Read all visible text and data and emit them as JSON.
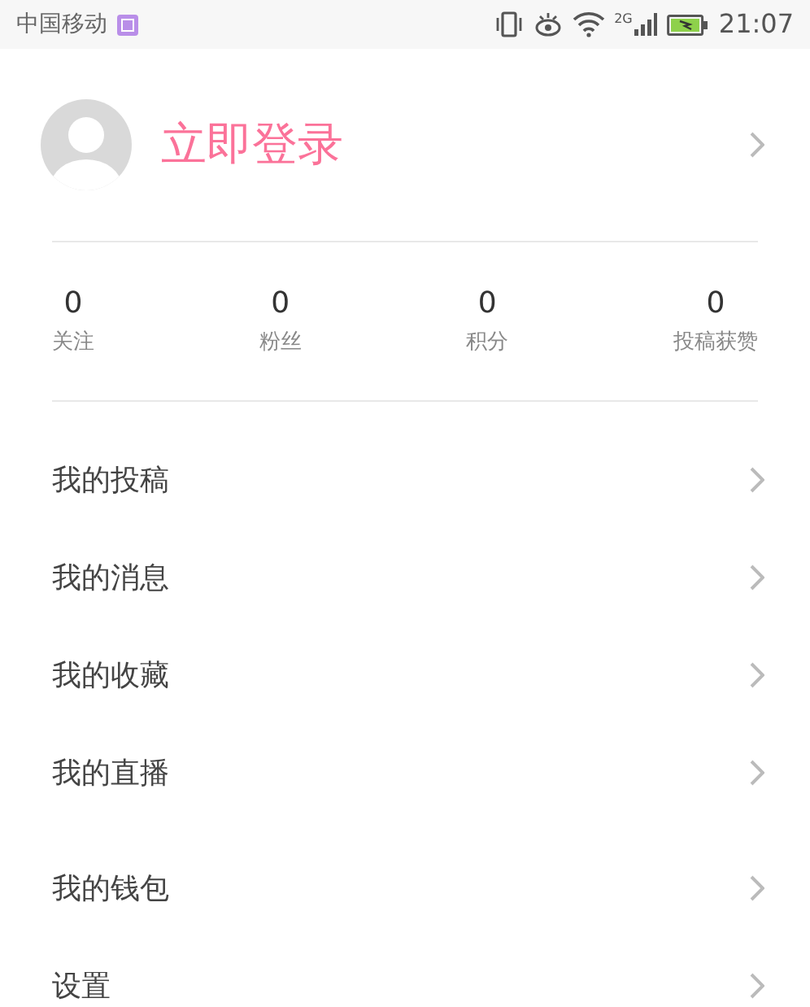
{
  "status_bar": {
    "carrier": "中国移动",
    "network": "2G",
    "time": "21:07"
  },
  "profile": {
    "login_label": "立即登录"
  },
  "stats": [
    {
      "value": "0",
      "label": "关注"
    },
    {
      "value": "0",
      "label": "粉丝"
    },
    {
      "value": "0",
      "label": "积分"
    },
    {
      "value": "0",
      "label": "投稿获赞"
    }
  ],
  "menu_sections": [
    {
      "items": [
        {
          "label": "我的投稿"
        },
        {
          "label": "我的消息"
        },
        {
          "label": "我的收藏"
        },
        {
          "label": "我的直播"
        }
      ]
    },
    {
      "items": [
        {
          "label": "我的钱包"
        },
        {
          "label": "设置"
        }
      ]
    }
  ]
}
